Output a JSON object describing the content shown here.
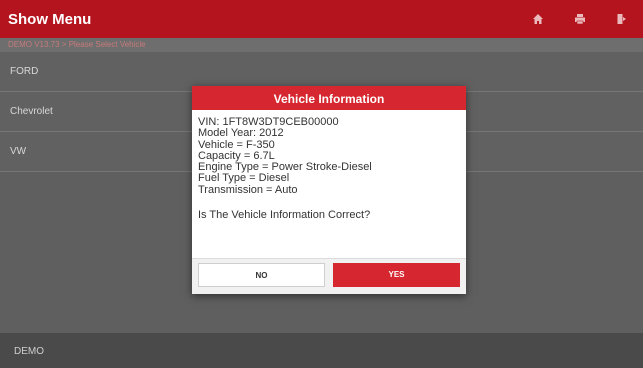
{
  "header": {
    "title": "Show Menu",
    "icons": [
      "home-icon",
      "print-icon",
      "exit-icon"
    ]
  },
  "breadcrumb": "DEMO V13.73 > Please Select Vehicle",
  "menu_items": [
    "FORD",
    "Chevrolet",
    "VW"
  ],
  "footer": "DEMO",
  "dialog": {
    "title": "Vehicle Information",
    "lines": [
      "VIN: 1FT8W3DT9CEB00000",
      "Model Year: 2012",
      "Vehicle = F-350",
      "Capacity = 6.7L",
      "Engine Type = Power Stroke-Diesel",
      "Fuel Type = Diesel",
      "Transmission = Auto"
    ],
    "question": "Is The Vehicle Information Correct?",
    "no_label": "NO",
    "yes_label": "YES"
  },
  "colors": {
    "header": "#b4141e",
    "dialog_title": "#d6262f",
    "yes_button": "#d6262f"
  }
}
